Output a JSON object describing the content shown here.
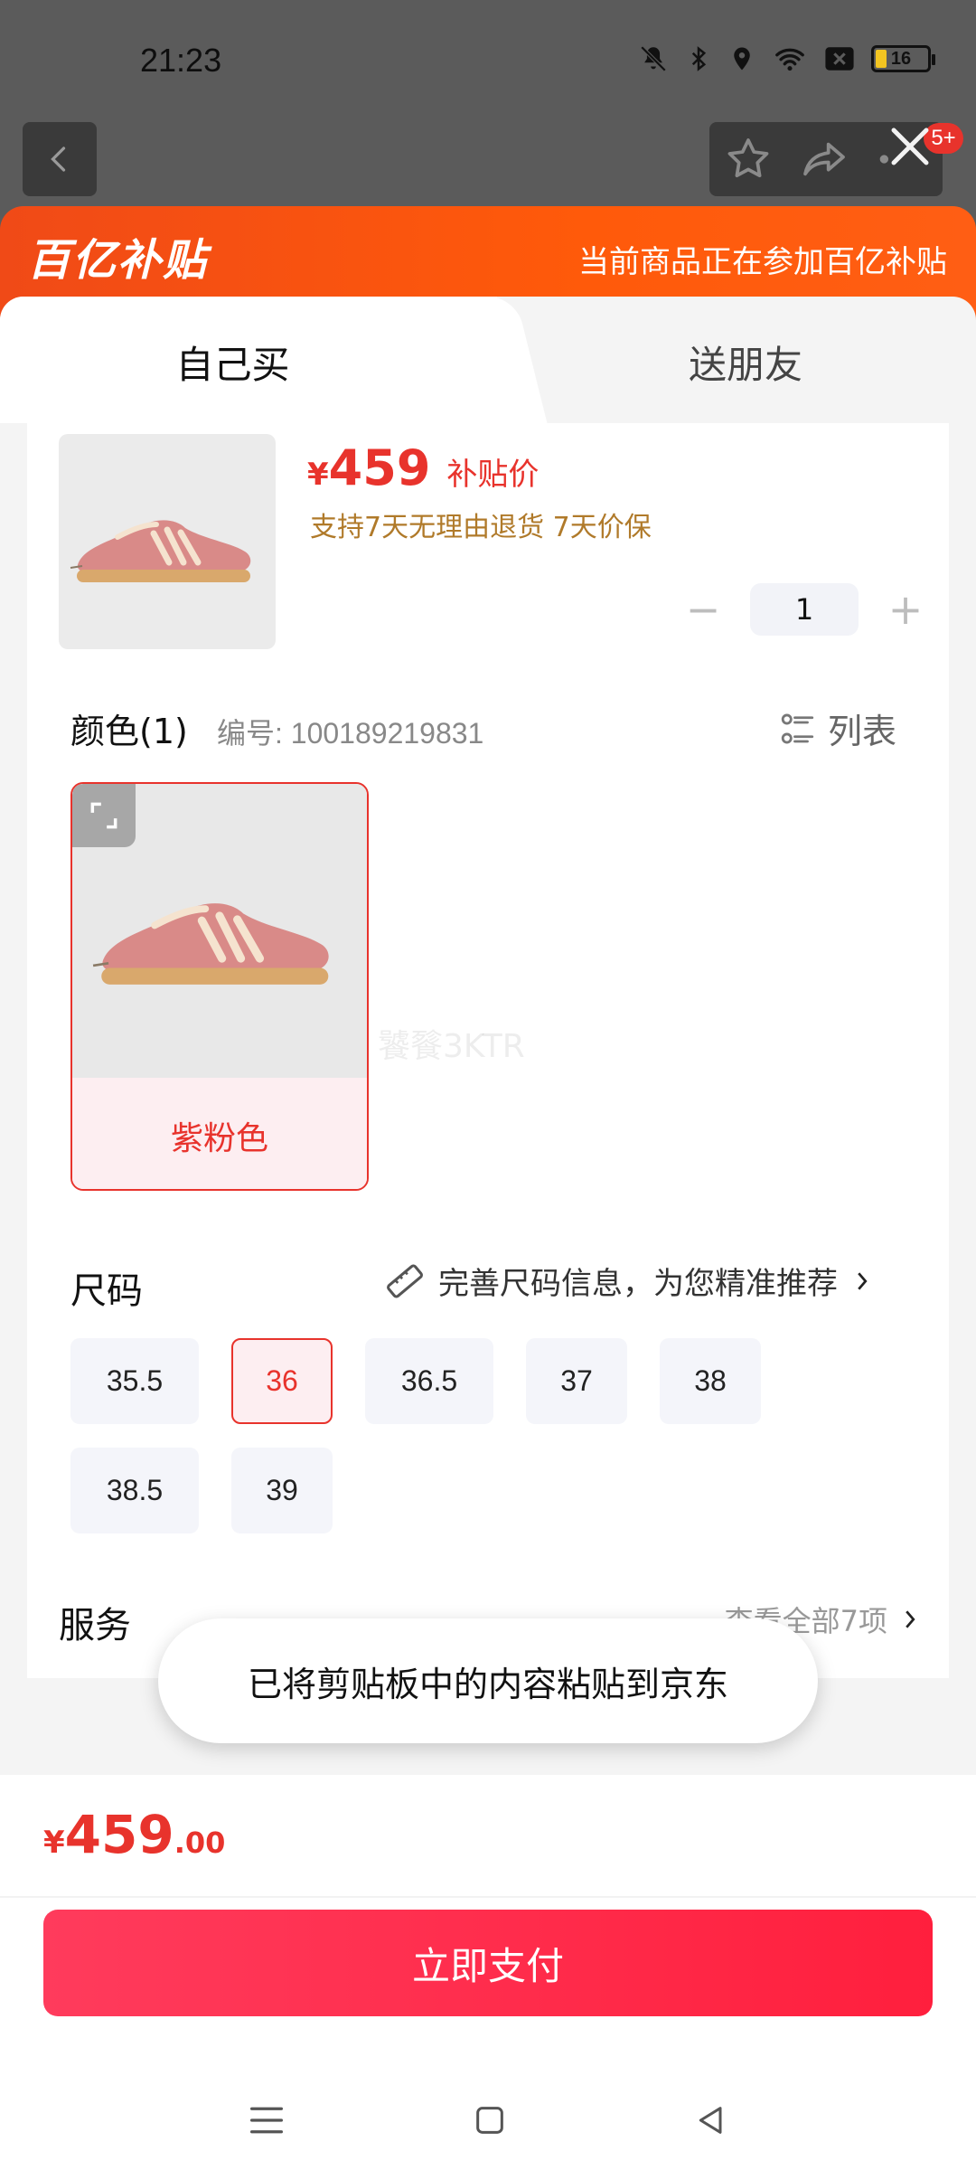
{
  "status_bar": {
    "time": "21:23",
    "battery": "16"
  },
  "header": {
    "badge": "5+"
  },
  "banner": {
    "logo": "百亿补贴",
    "text": "当前商品正在参加百亿补贴"
  },
  "tabs": [
    {
      "label": "自己买"
    },
    {
      "label": "送朋友"
    }
  ],
  "product": {
    "price_symbol": "¥",
    "price": "459",
    "price_tag": "补贴价",
    "promise": "支持7天无理由退货  7天价保",
    "quantity": "1",
    "minus": "−",
    "plus": "+"
  },
  "color": {
    "title": "颜色(1)",
    "code": "编号: 100189219831",
    "list_label": "列表",
    "options": [
      {
        "label": "紫粉色"
      }
    ],
    "watermark": "饕餮3KTR"
  },
  "size": {
    "title": "尺码",
    "hint": "完善尺码信息，为您精准推荐",
    "options": [
      "35.5",
      "36",
      "36.5",
      "37",
      "38",
      "38.5",
      "39"
    ],
    "selected": "36"
  },
  "service": {
    "title": "服务",
    "more": "查看全部7项"
  },
  "toast": "已将剪贴板中的内容粘贴到京东",
  "total": {
    "symbol": "¥",
    "integer": "459",
    "decimal": ".00"
  },
  "pay_button": "立即支付",
  "colors": {
    "accent": "#e8332c",
    "banner": "#ff5a0a",
    "promise": "#b07a2a"
  }
}
